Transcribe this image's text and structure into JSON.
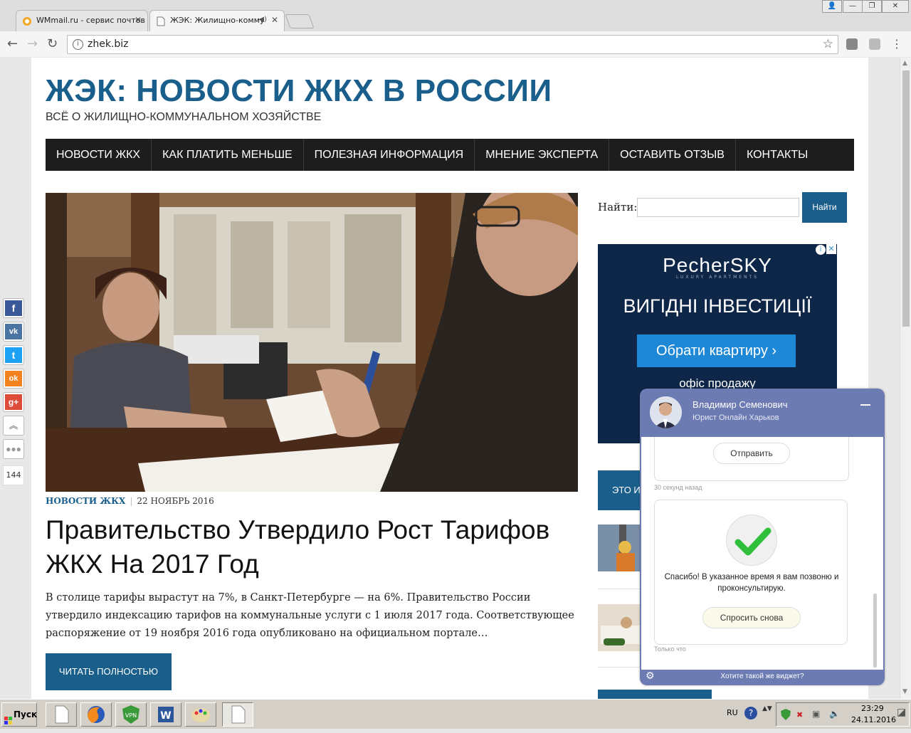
{
  "browser": {
    "tabs": [
      {
        "label": "WMmail.ru - сервис почтов",
        "active": false
      },
      {
        "label": "ЖЭК: Жилищно-комму",
        "active": true
      }
    ],
    "url": "zhek.biz"
  },
  "site": {
    "title": "ЖЭК: НОВОСТИ ЖКХ В РОССИИ",
    "subtitle": "ВСЁ О ЖИЛИЩНО-КОММУНАЛЬНОМ ХОЗЯЙСТВЕ",
    "nav": [
      "НОВОСТИ ЖКХ",
      "КАК ПЛАТИТЬ МЕНЬШЕ",
      "ПОЛЕЗНАЯ ИНФОРМАЦИЯ",
      "МНЕНИЕ ЭКСПЕРТА",
      "ОСТАВИТЬ ОТЗЫВ",
      "КОНТАКТЫ"
    ]
  },
  "post": {
    "category": "НОВОСТИ ЖКХ",
    "date": "22 НОЯБРЬ 2016",
    "title": "Правительство Утвердило Рост Тарифов ЖКХ На 2017 Год",
    "excerpt": "В столице тарифы вырастут на 7%, в Санкт-Петербурге — на 6%. Правительство России утвердило индексацию тарифов на коммунальные услуги с 1 июля 2017 года. Соответствующее распоряжение от 19 ноября 2016 года опубликовано на официальном портале…",
    "read_more": "ЧИТАТЬ ПОЛНОСТЬЮ"
  },
  "sidebar": {
    "search_label": "Найти:",
    "search_value": "",
    "search_button": "Найти",
    "block_label": "ЭТО И"
  },
  "ad": {
    "brand": "PecherSKY",
    "brand_sub": "LUXURY APARTMENTS",
    "headline": "ВИГІДНІ ІНВЕСТИЦІЇ",
    "cta": "Обрати квартиру ›",
    "office": "офіс продажу"
  },
  "share": {
    "count": "144",
    "buttons": [
      {
        "name": "facebook",
        "glyph": "f",
        "color": "#3b5998"
      },
      {
        "name": "vk",
        "glyph": "vk",
        "color": "#4c75a3"
      },
      {
        "name": "twitter",
        "glyph": "t",
        "color": "#1da1f2"
      },
      {
        "name": "odnoklassniki",
        "glyph": "ok",
        "color": "#f58220"
      },
      {
        "name": "google-plus",
        "glyph": "g+",
        "color": "#dd4b39"
      }
    ]
  },
  "chat": {
    "agent_name": "Владимир Семенович",
    "agent_role": "Юрист Онлайн Харьков",
    "send_label": "Отправить",
    "timestamp_1": "30 секунд назад",
    "thanks": "Спасибо! В указанное время я вам позвоню и проконсультирую.",
    "ask_again": "Спросить снова",
    "timestamp_2": "Только что",
    "promo": "Хотите такой же виджет?"
  },
  "taskbar": {
    "start": "Пуск",
    "lang": "RU",
    "time": "23:29",
    "date": "24.11.2016"
  },
  "colors": {
    "brand_blue": "#1a5f8c",
    "nav_bg": "#1d1d1d",
    "widget_purple": "#6d7bb3",
    "ad_bg": "#0e2648",
    "cta_blue": "#1e88d6"
  }
}
